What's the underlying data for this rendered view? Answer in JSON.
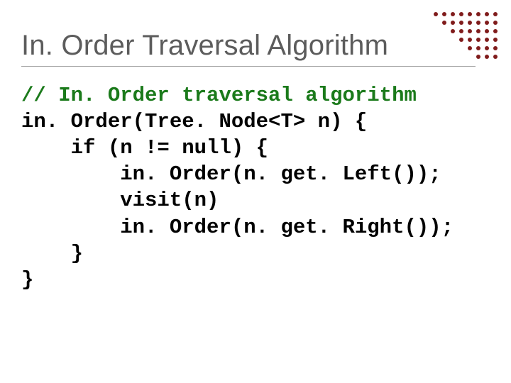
{
  "title": "In. Order Traversal Algorithm",
  "code": {
    "c0": "// In. Order traversal algorithm",
    "c1": "in. Order(Tree. Node<T> n) {",
    "c2": "    if (n != null) {",
    "c3": "        in. Order(n. get. Left());",
    "c4": "        visit(n)",
    "c5": "        in. Order(n. get. Right());",
    "c6": "    }",
    "c7": "}"
  }
}
